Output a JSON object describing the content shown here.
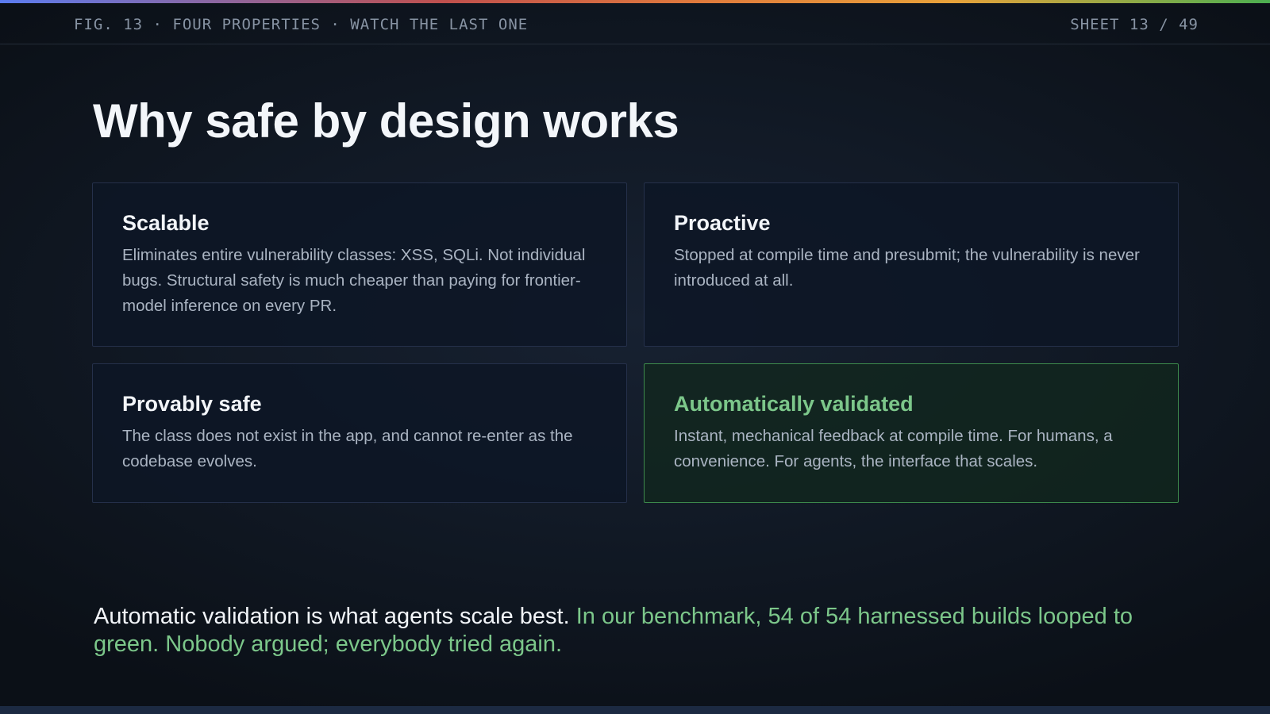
{
  "header": {
    "fig_label": "FIG. 13 · FOUR PROPERTIES · WATCH THE LAST ONE",
    "sheet_label": "SHEET 13 / 49"
  },
  "title": "Why safe by design works",
  "cards": [
    {
      "title": "Scalable",
      "body": "Eliminates entire vulnerability classes: XSS, SQLi. Not individual bugs. Structural safety is much cheaper than paying for frontier-model inference on every PR."
    },
    {
      "title": "Proactive",
      "body": "Stopped at compile time and presubmit; the vulnerability is never introduced at all."
    },
    {
      "title": "Provably safe",
      "body": "The class does not exist in the app, and cannot re-enter as the codebase evolves."
    },
    {
      "title": "Automatically validated",
      "body": "Instant, mechanical feedback at compile time. For humans, a convenience. For agents, the interface that scales."
    }
  ],
  "conclusion": {
    "lead": "Automatic validation is what agents scale best.",
    "accent": "In our benchmark, 54 of 54 harnessed builds looped to green. Nobody argued; everybody tried again."
  },
  "colors": {
    "accent_green": "#7cc78a",
    "highlight_border": "#3d8a4c",
    "background": "#0b1017"
  }
}
